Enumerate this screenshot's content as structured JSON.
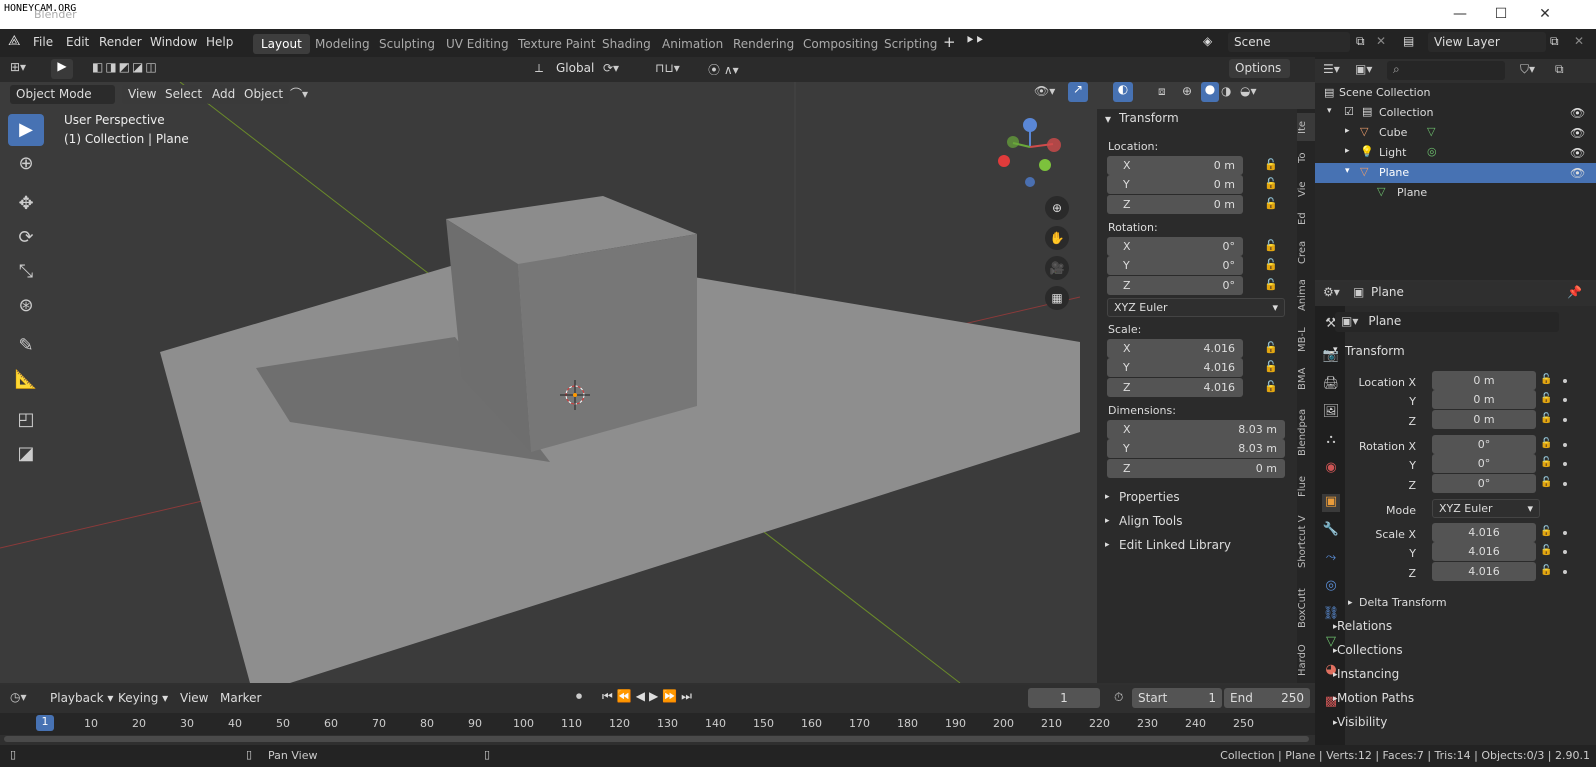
{
  "app": {
    "title": "Blender",
    "watermark": "HONEYCAM.ORG"
  },
  "menu": [
    "File",
    "Edit",
    "Render",
    "Window",
    "Help"
  ],
  "workspaces": [
    "Layout",
    "Modeling",
    "Sculpting",
    "UV Editing",
    "Texture Paint",
    "Shading",
    "Animation",
    "Rendering",
    "Compositing",
    "Scripting"
  ],
  "scene": {
    "name": "Scene",
    "view_layer": "View Layer"
  },
  "toolheader": {
    "orientation": "Global",
    "options": "Options"
  },
  "viewport": {
    "mode": "Object Mode",
    "menus": [
      "View",
      "Select",
      "Add",
      "Object"
    ],
    "overlay_title": "User Perspective",
    "overlay_sub": "(1) Collection | Plane"
  },
  "npanel": {
    "transform": "Transform",
    "location": "Location:",
    "rotation": "Rotation:",
    "scale": "Scale:",
    "dimensions": "Dimensions:",
    "loc": [
      "0 m",
      "0 m",
      "0 m"
    ],
    "rot": [
      "0°",
      "0°",
      "0°"
    ],
    "rot_mode": "XYZ Euler",
    "scl": [
      "4.016",
      "4.016",
      "4.016"
    ],
    "dim": [
      "8.03 m",
      "8.03 m",
      "0 m"
    ],
    "axes": [
      "X",
      "Y",
      "Z"
    ],
    "sections": [
      "Properties",
      "Align Tools",
      "Edit Linked Library"
    ],
    "tabs": [
      "Ite",
      "To",
      "Vie",
      "Ed",
      "Crea",
      "Anima",
      "MB-L",
      "BMA",
      "Blendpea",
      "Flue",
      "Shortcut V",
      "BoxCutt",
      "HardO"
    ]
  },
  "outliner": {
    "root": "Scene Collection",
    "items": [
      "Collection",
      "Cube",
      "Light",
      "Plane",
      "Plane"
    ]
  },
  "props": {
    "object": "Plane",
    "name_field": "Plane",
    "transform": "Transform",
    "labels": [
      "Location X",
      "Y",
      "Z",
      "Rotation X",
      "Y",
      "Z",
      "Mode",
      "Scale X",
      "Y",
      "Z"
    ],
    "loc": [
      "0 m",
      "0 m",
      "0 m"
    ],
    "rot": [
      "0°",
      "0°",
      "0°"
    ],
    "mode": "XYZ Euler",
    "scl": [
      "4.016",
      "4.016",
      "4.016"
    ],
    "delta": "Delta Transform",
    "sections": [
      "Relations",
      "Collections",
      "Instancing",
      "Motion Paths",
      "Visibility"
    ]
  },
  "timeline": {
    "menus": [
      "Playback",
      "Keying",
      "View",
      "Marker"
    ],
    "frame": "1",
    "start_label": "Start",
    "start": "1",
    "end_label": "End",
    "end": "250",
    "ticks": [
      "1",
      "10",
      "20",
      "30",
      "40",
      "50",
      "60",
      "70",
      "80",
      "90",
      "100",
      "110",
      "120",
      "130",
      "140",
      "150",
      "160",
      "170",
      "180",
      "190",
      "200",
      "210",
      "220",
      "230",
      "240",
      "250"
    ]
  },
  "status": {
    "action": "Pan View",
    "info": "Collection | Plane | Verts:12 | Faces:7 | Tris:14 | Objects:0/3 | 2.90.1"
  }
}
